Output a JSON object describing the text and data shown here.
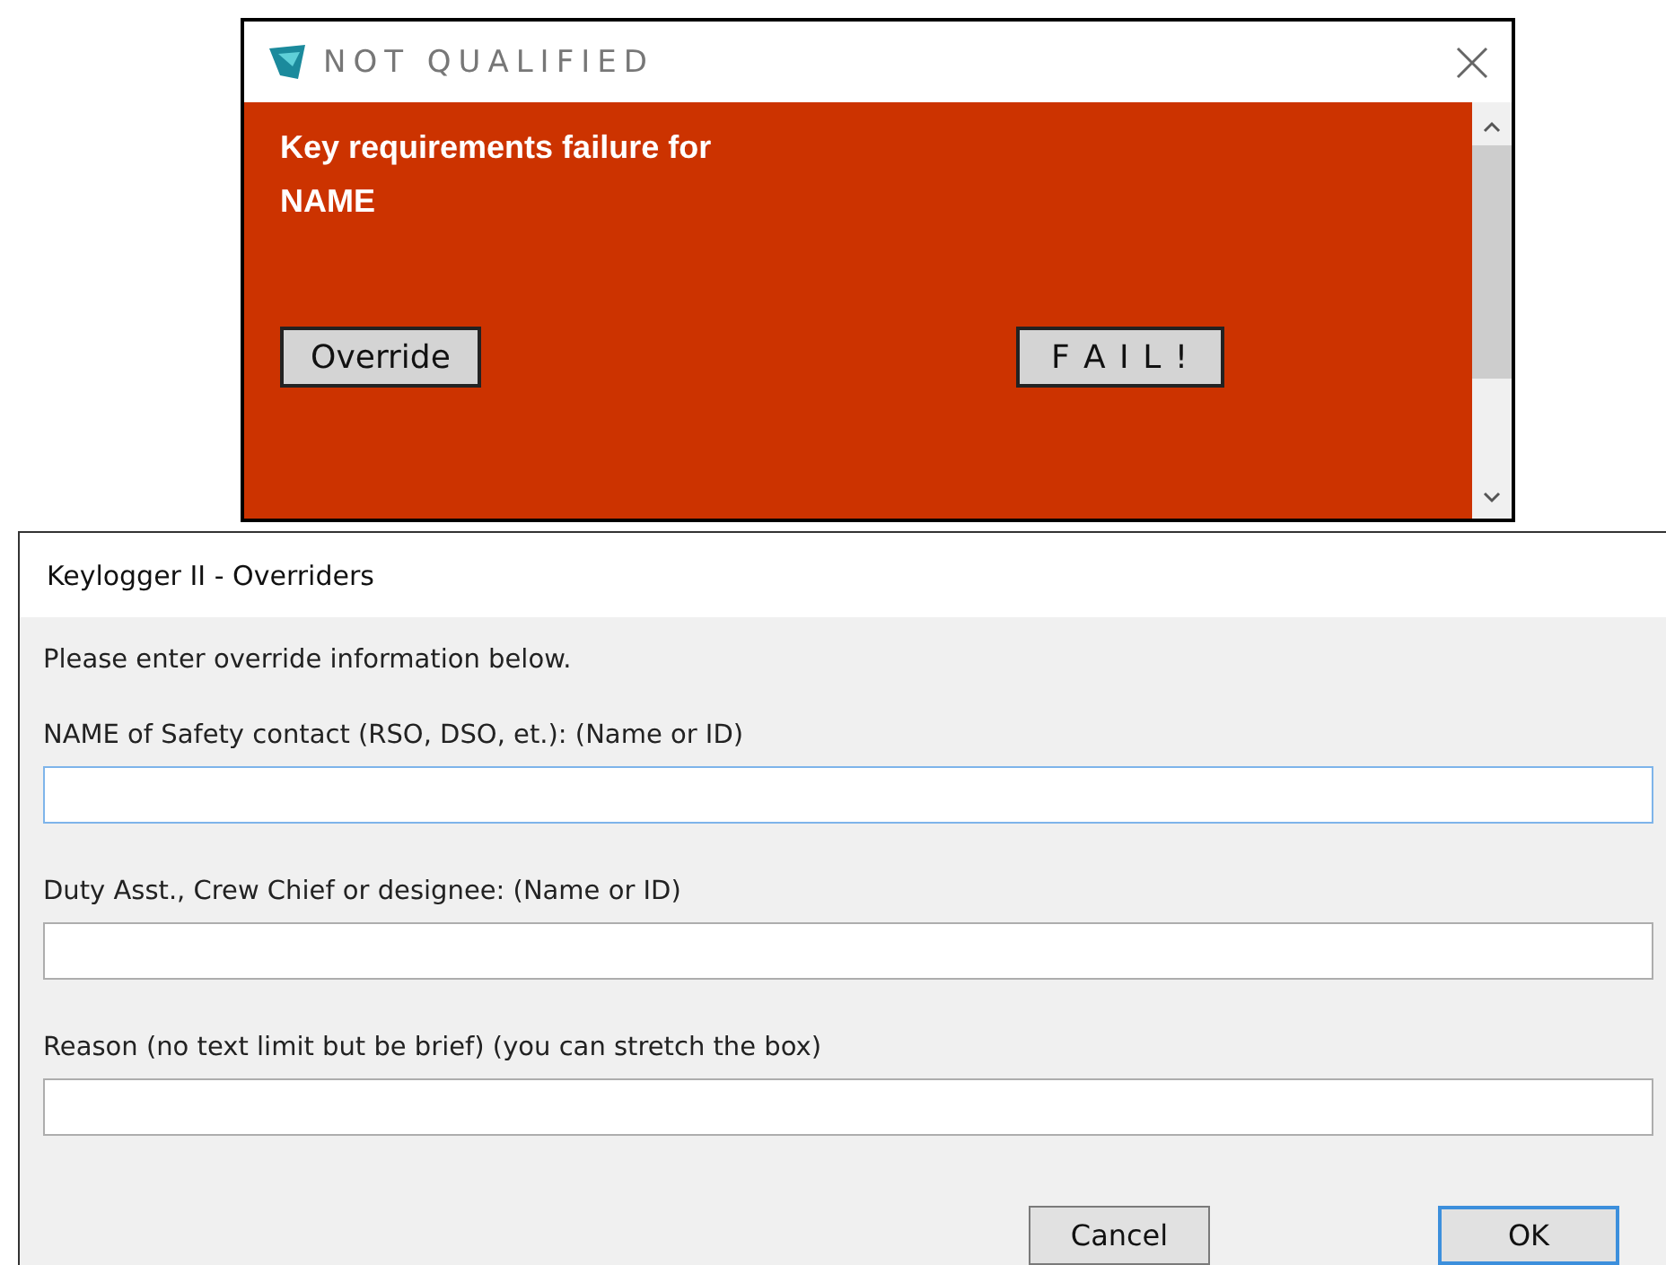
{
  "alert": {
    "title": "NOT QUALIFIED",
    "heading_lines": [
      "Key requirements failure for",
      "NAME"
    ],
    "buttons": [
      {
        "label": "Override",
        "kind": "plain"
      },
      {
        "label": "F A I L !",
        "kind": "spaced"
      }
    ]
  },
  "dialog": {
    "title": "Keylogger II - Overriders",
    "intro": "Please enter override information below.",
    "fields": [
      {
        "label": "NAME of Safety contact (RSO, DSO, et.): (Name or ID)",
        "focused": true
      },
      {
        "label": "Duty Asst., Crew Chief or designee: (Name or ID)",
        "focused": false
      },
      {
        "label": "Reason (no text limit but be brief) (you can stretch the box)",
        "focused": false
      }
    ],
    "buttons": [
      {
        "label": "Cancel",
        "default": false
      },
      {
        "label": "OK",
        "default": true
      }
    ]
  }
}
